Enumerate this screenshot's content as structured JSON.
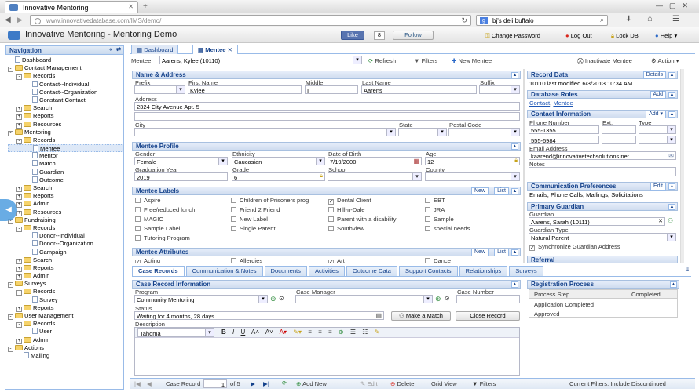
{
  "browser": {
    "tab_title": "Innovative Mentoring",
    "url": "www.innovativedatabase.com/IMS/demo/",
    "search_value": "bj's deli buffalo"
  },
  "app": {
    "title": "Innovative Mentoring - Mentoring Demo",
    "like_label": "Like",
    "like_count": "8",
    "follow_label": "Follow",
    "change_password": "Change Password",
    "log_out": "Log Out",
    "lock_db": "Lock DB",
    "help": "Help"
  },
  "nav": {
    "title": "Navigation",
    "items": [
      {
        "label": "Dashboard",
        "level": 0,
        "type": "doc"
      },
      {
        "label": "Contact Management",
        "level": 0,
        "type": "folder",
        "exp": "-"
      },
      {
        "label": "Records",
        "level": 1,
        "type": "folder",
        "exp": "-"
      },
      {
        "label": "Contact--Individual",
        "level": 2,
        "type": "doc"
      },
      {
        "label": "Contact--Organization",
        "level": 2,
        "type": "doc"
      },
      {
        "label": "Constant Contact",
        "level": 2,
        "type": "doc"
      },
      {
        "label": "Search",
        "level": 1,
        "type": "folder",
        "exp": "+"
      },
      {
        "label": "Reports",
        "level": 1,
        "type": "folder",
        "exp": "+"
      },
      {
        "label": "Resources",
        "level": 1,
        "type": "folder",
        "exp": "+"
      },
      {
        "label": "Mentoring",
        "level": 0,
        "type": "folder",
        "exp": "-"
      },
      {
        "label": "Records",
        "level": 1,
        "type": "folder",
        "exp": "-"
      },
      {
        "label": "Mentee",
        "level": 2,
        "type": "doc",
        "selected": true
      },
      {
        "label": "Mentor",
        "level": 2,
        "type": "doc"
      },
      {
        "label": "Match",
        "level": 2,
        "type": "doc"
      },
      {
        "label": "Guardian",
        "level": 2,
        "type": "doc"
      },
      {
        "label": "Outcome",
        "level": 2,
        "type": "doc"
      },
      {
        "label": "Search",
        "level": 1,
        "type": "folder",
        "exp": "+"
      },
      {
        "label": "Reports",
        "level": 1,
        "type": "folder",
        "exp": "+"
      },
      {
        "label": "Admin",
        "level": 1,
        "type": "folder",
        "exp": "+"
      },
      {
        "label": "Resources",
        "level": 1,
        "type": "folder",
        "exp": "+"
      },
      {
        "label": "Fundraising",
        "level": 0,
        "type": "folder",
        "exp": "-"
      },
      {
        "label": "Records",
        "level": 1,
        "type": "folder",
        "exp": "-"
      },
      {
        "label": "Donor--Individual",
        "level": 2,
        "type": "doc"
      },
      {
        "label": "Donor--Organization",
        "level": 2,
        "type": "doc"
      },
      {
        "label": "Campaign",
        "level": 2,
        "type": "doc"
      },
      {
        "label": "Search",
        "level": 1,
        "type": "folder",
        "exp": "+"
      },
      {
        "label": "Reports",
        "level": 1,
        "type": "folder",
        "exp": "+"
      },
      {
        "label": "Admin",
        "level": 1,
        "type": "folder",
        "exp": "+"
      },
      {
        "label": "Surveys",
        "level": 0,
        "type": "folder",
        "exp": "-"
      },
      {
        "label": "Records",
        "level": 1,
        "type": "folder",
        "exp": "-"
      },
      {
        "label": "Survey",
        "level": 2,
        "type": "doc"
      },
      {
        "label": "Reports",
        "level": 1,
        "type": "folder",
        "exp": "+"
      },
      {
        "label": "User Management",
        "level": 0,
        "type": "folder",
        "exp": "-"
      },
      {
        "label": "Records",
        "level": 1,
        "type": "folder",
        "exp": "-"
      },
      {
        "label": "User",
        "level": 2,
        "type": "doc"
      },
      {
        "label": "Admin",
        "level": 1,
        "type": "folder",
        "exp": "+"
      },
      {
        "label": "Actions",
        "level": 0,
        "type": "folder",
        "exp": "-"
      },
      {
        "label": "Mailing",
        "level": 1,
        "type": "doc"
      }
    ]
  },
  "tabs": {
    "dashboard": "Dashboard",
    "mentee": "Mentee"
  },
  "toolbar": {
    "mentee_label": "Mentee:",
    "mentee_value": "Aarens, Kylee (10110)",
    "refresh": "Refresh",
    "filters": "Filters",
    "new_mentee": "New Mentee",
    "inactivate": "Inactivate Mentee",
    "action": "Action"
  },
  "name_addr": {
    "title": "Name & Address",
    "prefix": "Prefix",
    "first_name": "First Name",
    "first_value": "Kylee",
    "middle": "Middle",
    "middle_value": "I",
    "last_name": "Last Name",
    "last_value": "Aarens",
    "suffix": "Suffix",
    "address": "Address",
    "address_value": "2324 City Avenue Apt. 5",
    "city": "City",
    "state": "State",
    "postal": "Postal Code"
  },
  "profile": {
    "title": "Mentee Profile",
    "gender": "Gender",
    "gender_value": "Female",
    "ethnicity": "Ethnicity",
    "ethnicity_value": "Caucasian",
    "dob": "Date of Birth",
    "dob_value": "7/19/2000",
    "age": "Age",
    "age_value": "12",
    "grad": "Graduation Year",
    "grad_value": "2019",
    "grade": "Grade",
    "grade_value": "6",
    "school": "School",
    "county": "County"
  },
  "labels": {
    "title": "Mentee Labels",
    "new": "New",
    "list": "List",
    "items": [
      {
        "label": "Aspire",
        "checked": false
      },
      {
        "label": "Children of Prisoners prog",
        "checked": false
      },
      {
        "label": "Dental Client",
        "checked": true
      },
      {
        "label": "EBT",
        "checked": false
      },
      {
        "label": "Free/reduced lunch",
        "checked": false
      },
      {
        "label": "Friend 2 Friend",
        "checked": false
      },
      {
        "label": "Hill-n-Dale",
        "checked": false
      },
      {
        "label": "JRA",
        "checked": false
      },
      {
        "label": "MAGIC",
        "checked": false
      },
      {
        "label": "New Label",
        "checked": false
      },
      {
        "label": "Parent with a disability",
        "checked": false
      },
      {
        "label": "Sample",
        "checked": false
      },
      {
        "label": "Sample Label",
        "checked": false
      },
      {
        "label": "Single Parent",
        "checked": false
      },
      {
        "label": "Southview",
        "checked": false
      },
      {
        "label": "special needs",
        "checked": false
      },
      {
        "label": "Tutoring Program",
        "checked": false
      }
    ]
  },
  "attributes": {
    "title": "Mentee Attributes",
    "new": "New",
    "list": "List",
    "items": [
      {
        "label": "Acting",
        "checked": true
      },
      {
        "label": "Allergies",
        "checked": false
      },
      {
        "label": "Art",
        "checked": true
      },
      {
        "label": "Dance",
        "checked": false
      }
    ]
  },
  "record_data": {
    "title": "Record Data",
    "details": "Details",
    "id": "10110 last modified 6/3/2013 10:34 AM"
  },
  "db_roles": {
    "title": "Database Roles",
    "add": "Add",
    "contact": "Contact",
    "mentee": "Mentee"
  },
  "contact_info": {
    "title": "Contact Information",
    "add": "Add",
    "phone": "Phone Number",
    "ext": "Ext.",
    "type": "Type",
    "phone1": "555-1355",
    "phone2": "555-6984",
    "email_label": "Email Address",
    "email": "kaarend@innovativetechsolutions.net",
    "notes": "Notes"
  },
  "comm_pref": {
    "title": "Communication Preferences",
    "edit": "Edit",
    "value": "Emails, Phone Calls, Mailings, Solicitations"
  },
  "guardian": {
    "title": "Primary Guardian",
    "label": "Guardian",
    "value": "Aarens, Sarah (10111)",
    "type_label": "Guardian Type",
    "type_value": "Natural Parent",
    "sync": "Synchronize Guardian Address"
  },
  "referral": {
    "title": "Referral"
  },
  "bottom_tabs": [
    "Case Records",
    "Communication & Notes",
    "Documents",
    "Activities",
    "Outcome Data",
    "Support Contacts",
    "Relationships",
    "Surveys"
  ],
  "case_info": {
    "title": "Case Record Information",
    "program": "Program",
    "program_value": "Community Mentoring",
    "manager": "Case Manager",
    "number": "Case Number",
    "status": "Status",
    "status_value": "Waiting for 4 months, 28 days.",
    "make_match": "Make a Match",
    "close_record": "Close Record",
    "description": "Description",
    "font": "Tahoma"
  },
  "registration": {
    "title": "Registration Process",
    "col_step": "Process Step",
    "col_completed": "Completed",
    "rows": [
      "Application Completed",
      "Approved"
    ]
  },
  "pager": {
    "case_record": "Case Record",
    "page": "1",
    "of": "of 5",
    "add_new": "Add New",
    "edit": "Edit",
    "delete": "Delete",
    "grid_view": "Grid View",
    "filters": "Filters",
    "current_filters": "Current Filters: Include Discontinued"
  }
}
